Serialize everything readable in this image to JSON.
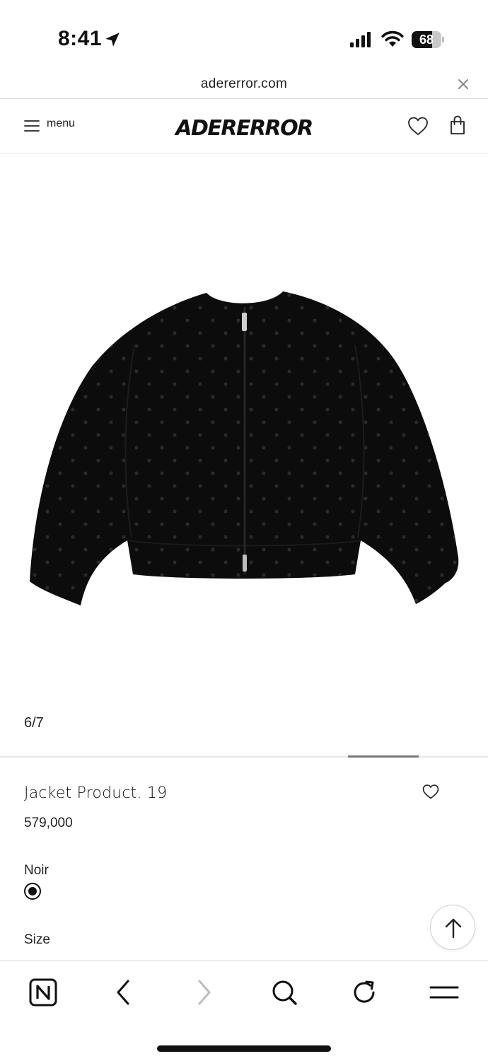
{
  "status_bar": {
    "time": "8:41",
    "battery_percent": "68",
    "battery_level": 0.68,
    "icons": [
      "location-arrow-icon",
      "cellular-signal-icon",
      "wifi-icon",
      "battery-icon"
    ]
  },
  "browser": {
    "url": "adererror.com",
    "close_icon": "close-icon"
  },
  "header": {
    "menu_label": "menu",
    "logo": "ADERERROR",
    "icons": [
      "hamburger-icon",
      "heart-icon",
      "shopping-bag-icon"
    ]
  },
  "gallery": {
    "counter": "6/7",
    "current": 6,
    "total": 7
  },
  "product": {
    "name": "Jacket Product. 19",
    "price": "579,000",
    "color_label": "Noir",
    "color_selected": "#111111",
    "size_label": "Size"
  },
  "toolbar": {
    "icons": [
      "naver-home-icon",
      "back-icon",
      "forward-icon",
      "search-icon",
      "reload-icon",
      "more-menu-icon"
    ]
  },
  "colors": {
    "background": "#ffffff",
    "text": "#111111",
    "divider": "#d9d9d9",
    "disabled_icon": "#bdbdbd"
  }
}
